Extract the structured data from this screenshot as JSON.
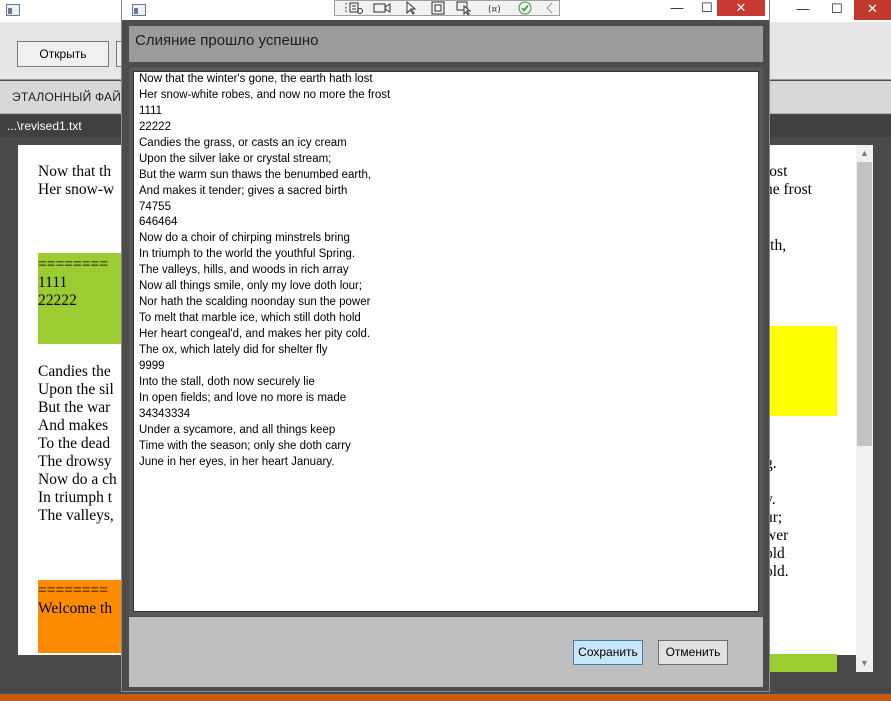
{
  "background_window": {
    "controls": {
      "minimize": "—",
      "maximize": "☐",
      "close": "✕"
    },
    "toolbar": {
      "open_label": "Открыть"
    },
    "reference_label": "ЭТАЛОННЫЙ ФАЙЛ",
    "path_label": "...\\revised1.txt",
    "doc": {
      "text_a": [
        "Now that th",
        "Her snow-w"
      ],
      "green_text": [
        "========",
        "1111",
        "22222"
      ],
      "text_b": [
        "Candies the",
        "Upon the sil",
        "But the war",
        "And makes",
        "To the dead",
        "The drowsy",
        "Now do a ch",
        "In triumph t",
        "The valleys,"
      ],
      "orange_text": [
        "========",
        "Welcome th"
      ],
      "right_a": [
        "lost",
        "he frost"
      ],
      "right_b": [
        "rth,"
      ],
      "right_c": [
        ",",
        "g."
      ],
      "right_d": [
        "y.",
        "ur;",
        "wer",
        "old",
        "old."
      ]
    },
    "scroll": {
      "up": "▲",
      "down": "▼"
    },
    "colors": {
      "green": "#9acd32",
      "orange": "#ff8c00",
      "yellow": "#ffff00",
      "taskbar": "#c45c1a"
    }
  },
  "dialog": {
    "controls": {
      "minimize": "—",
      "maximize": "☐",
      "close": "✕"
    },
    "debug_toolbar": {
      "icons": [
        "grip-icon",
        "inspect-tree-icon",
        "camera-icon",
        "select-element-icon",
        "highlight-rect-icon",
        "track-focus-icon",
        "binding-icon",
        "check-icon",
        "back-icon"
      ]
    },
    "title": "Слияние прошло успешно",
    "lines": [
      "Now that the winter's gone, the earth hath lost",
      "Her snow-white robes, and now no more the frost",
      "1111",
      "22222",
      "Candies the grass, or casts an icy cream",
      "Upon the silver lake or crystal stream;",
      "But the warm sun thaws the benumbed earth,",
      "And makes it tender; gives a sacred birth",
      "74755",
      "646464",
      "Now do a choir of chirping minstrels bring",
      "In triumph to the world the youthful Spring.",
      "The valleys, hills, and woods in rich array",
      "Now all things smile, only my love doth lour;",
      "Nor hath the scalding noonday sun the power",
      "To melt that marble ice, which still doth hold",
      "Her heart congeal'd, and makes her pity cold.",
      "The ox, which lately did for shelter fly",
      "9999",
      "Into the stall, doth now securely lie",
      "In open fields; and love no more is made",
      "34343334",
      "Under a sycamore, and all things keep",
      "Time with the season; only she doth carry",
      "June in her eyes, in her heart January."
    ],
    "buttons": {
      "save": "Сохранить",
      "cancel": "Отменить"
    },
    "colors": {
      "save_bg": "#c9e5f8",
      "save_border": "#3c7fb1",
      "close_bg": "#c73a32"
    }
  }
}
